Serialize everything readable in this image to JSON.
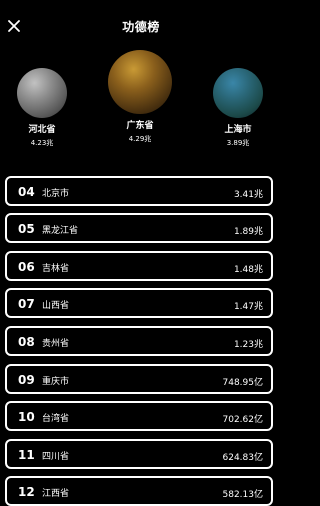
{
  "header": {
    "title": "功德榜"
  },
  "top3": [
    {
      "place": 2,
      "name": "河北省",
      "value": "4.23兆",
      "color": "#8d8d8d"
    },
    {
      "place": 1,
      "name": "广东省",
      "value": "4.29兆",
      "color": "#8a5f1c"
    },
    {
      "place": 3,
      "name": "上海市",
      "value": "3.89兆",
      "color": "#2a6778"
    }
  ],
  "rows": [
    {
      "rank": "04",
      "name": "北京市",
      "value": "3.41兆"
    },
    {
      "rank": "05",
      "name": "黑龙江省",
      "value": "1.89兆"
    },
    {
      "rank": "06",
      "name": "吉林省",
      "value": "1.48兆"
    },
    {
      "rank": "07",
      "name": "山西省",
      "value": "1.47兆"
    },
    {
      "rank": "08",
      "name": "贵州省",
      "value": "1.23兆"
    },
    {
      "rank": "09",
      "name": "重庆市",
      "value": "748.95亿"
    },
    {
      "rank": "10",
      "name": "台湾省",
      "value": "702.62亿"
    },
    {
      "rank": "11",
      "name": "四川省",
      "value": "624.83亿"
    },
    {
      "rank": "12",
      "name": "江西省",
      "value": "582.13亿"
    }
  ]
}
